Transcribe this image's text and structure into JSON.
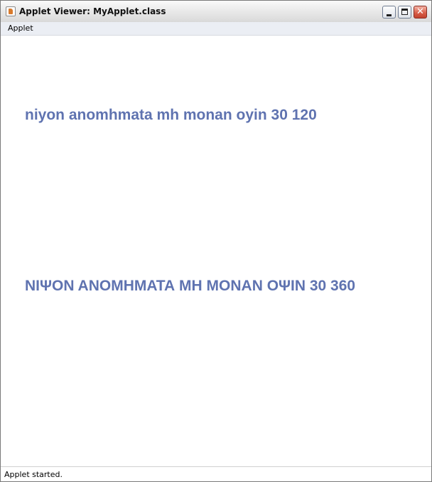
{
  "window": {
    "title": "Applet Viewer: MyApplet.class",
    "icon": "java-cup-icon",
    "controls": {
      "minimize_icon": "minimize-icon",
      "maximize_icon": "maximize-icon",
      "close_icon": "close-icon",
      "close_glyph": "✕"
    }
  },
  "menubar": {
    "items": [
      {
        "label": "Applet"
      }
    ]
  },
  "applet": {
    "text_color": "#5f73b0",
    "lines": [
      {
        "text": "niyon anomhmata mh monan oyin 30 120"
      },
      {
        "text": "ΝΙΨΟΝ ΑΝΟΜΗΜΑΤΑ ΜΗ ΜΟΝΑΝ ΟΨΙΝ 30 360"
      }
    ]
  },
  "status": {
    "text": "Applet started."
  }
}
